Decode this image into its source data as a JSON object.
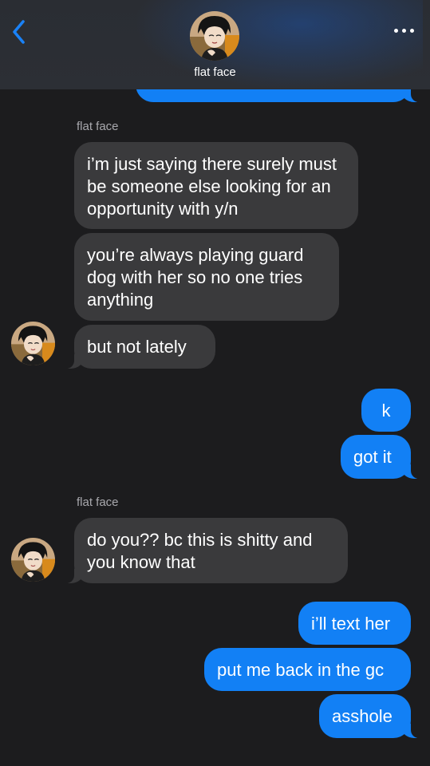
{
  "header": {
    "contact_name": "flat face",
    "back_icon": "chevron-left-icon",
    "more_icon": "ellipsis-icon",
    "accent": "#1a82f7"
  },
  "thread": {
    "sender_label_1": "flat face",
    "incoming_1": "i’m just saying there surely must be someone else looking for an opportunity with y/n",
    "incoming_2": "you’re always playing guard dog with her so no one tries anything",
    "incoming_3": "but not lately",
    "outgoing_1": "k",
    "outgoing_2": "got it",
    "sender_label_2": "flat face",
    "incoming_4": "do you?? bc this is shitty and you know that",
    "outgoing_3": "i’ll text her",
    "outgoing_4": "put me back in the gc",
    "outgoing_5": "asshole"
  },
  "colors": {
    "background": "#1c1c1e",
    "incoming_bubble": "#3a3a3c",
    "outgoing_bubble": "#1280f5",
    "sender_label": "#a8a8ad"
  }
}
